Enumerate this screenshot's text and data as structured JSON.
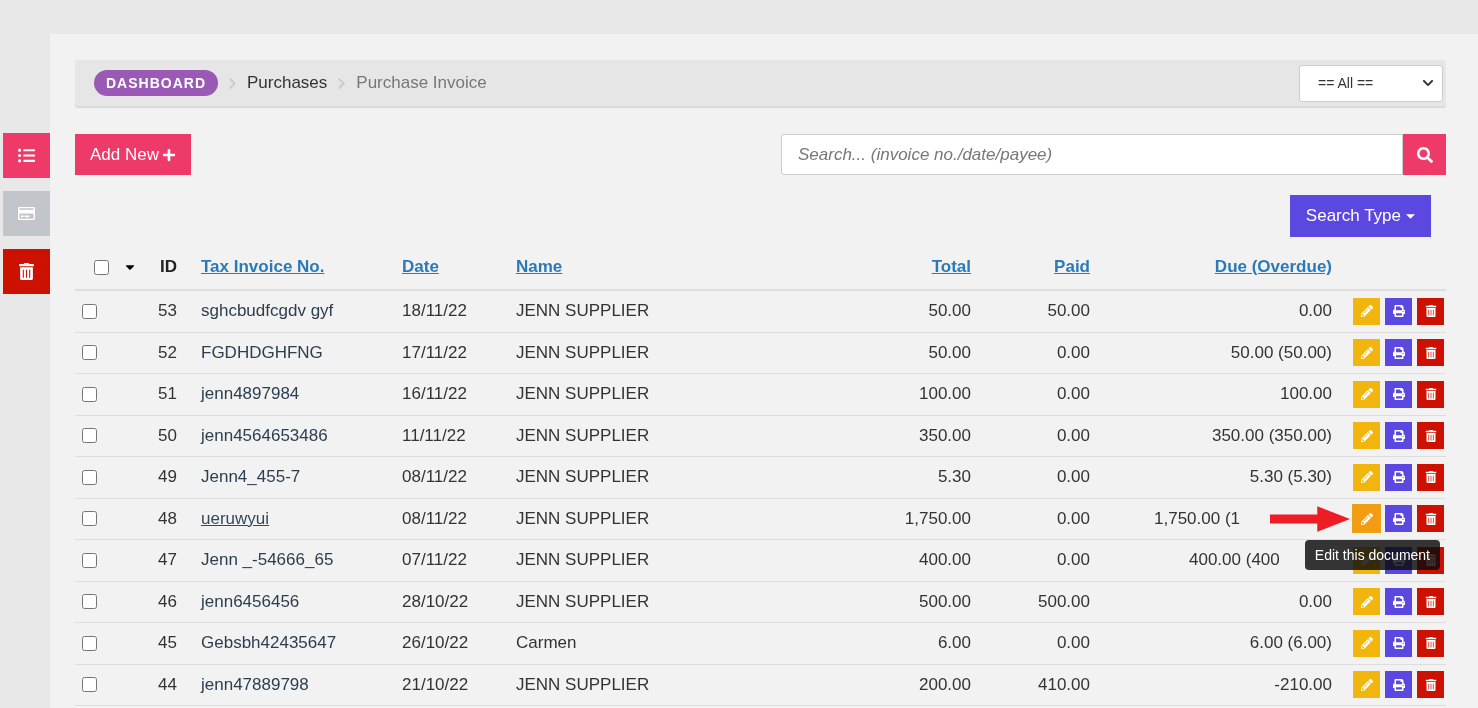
{
  "sidebar": {
    "items": [
      {
        "kind": "list",
        "color": "#ee3a68"
      },
      {
        "kind": "card",
        "color": "#c2c6ca"
      },
      {
        "kind": "trash",
        "color": "#cc1100"
      }
    ]
  },
  "breadcrumb": {
    "items": [
      {
        "label": "DASHBOARD",
        "kind": "badge"
      },
      {
        "label": "Purchases",
        "kind": "link"
      },
      {
        "label": "Purchase Invoice",
        "kind": "current"
      }
    ]
  },
  "filter_select": {
    "value": "== All =="
  },
  "add_button": {
    "label": "Add New"
  },
  "search": {
    "placeholder": "Search... (invoice no./date/payee)"
  },
  "search_type_button": {
    "label": "Search Type"
  },
  "table": {
    "columns": [
      "ID",
      "Tax Invoice No.",
      "Date",
      "Name",
      "Total",
      "Paid",
      "Due (Overdue)"
    ],
    "header_checked": false,
    "rows": [
      {
        "id": "53",
        "invoice": "sghcbudfcgdv gyf",
        "date": "18/11/22",
        "name": "JENN SUPPLIER",
        "total": "50.00",
        "paid": "50.00",
        "due": "0.00",
        "checked": false,
        "hovered": false
      },
      {
        "id": "52",
        "invoice": "FGDHDGHFNG",
        "date": "17/11/22",
        "name": "JENN SUPPLIER",
        "total": "50.00",
        "paid": "0.00",
        "due": "50.00 (50.00)",
        "checked": false,
        "hovered": false
      },
      {
        "id": "51",
        "invoice": "jenn4897984",
        "date": "16/11/22",
        "name": "JENN SUPPLIER",
        "total": "100.00",
        "paid": "0.00",
        "due": "100.00",
        "checked": false,
        "hovered": false
      },
      {
        "id": "50",
        "invoice": "jenn4564653486",
        "date": "11/11/22",
        "name": "JENN SUPPLIER",
        "total": "350.00",
        "paid": "0.00",
        "due": "350.00 (350.00)",
        "checked": false,
        "hovered": false
      },
      {
        "id": "49",
        "invoice": "Jenn4_455-7",
        "date": "08/11/22",
        "name": "JENN SUPPLIER",
        "total": "5.30",
        "paid": "0.00",
        "due": "5.30 (5.30)",
        "checked": false,
        "hovered": false
      },
      {
        "id": "48",
        "invoice": "ueruwyui",
        "date": "08/11/22",
        "name": "JENN SUPPLIER",
        "total": "1,750.00",
        "paid": "0.00",
        "due": "1,750.00 (1",
        "checked": false,
        "hovered": true
      },
      {
        "id": "47",
        "invoice": "Jenn _-54666_65",
        "date": "07/11/22",
        "name": "JENN SUPPLIER",
        "total": "400.00",
        "paid": "0.00",
        "due": "400.00 (400",
        "checked": false,
        "hovered": false
      },
      {
        "id": "46",
        "invoice": "jenn6456456",
        "date": "28/10/22",
        "name": "JENN SUPPLIER",
        "total": "500.00",
        "paid": "500.00",
        "due": "0.00",
        "checked": false,
        "hovered": false
      },
      {
        "id": "45",
        "invoice": "Gebsbh42435647",
        "date": "26/10/22",
        "name": "Carmen",
        "total": "6.00",
        "paid": "0.00",
        "due": "6.00 (6.00)",
        "checked": false,
        "hovered": false
      },
      {
        "id": "44",
        "invoice": "jenn47889798",
        "date": "21/10/22",
        "name": "JENN SUPPLIER",
        "total": "200.00",
        "paid": "410.00",
        "due": "-210.00",
        "checked": false,
        "hovered": false
      }
    ]
  },
  "tooltip": {
    "text": "Edit this document"
  }
}
